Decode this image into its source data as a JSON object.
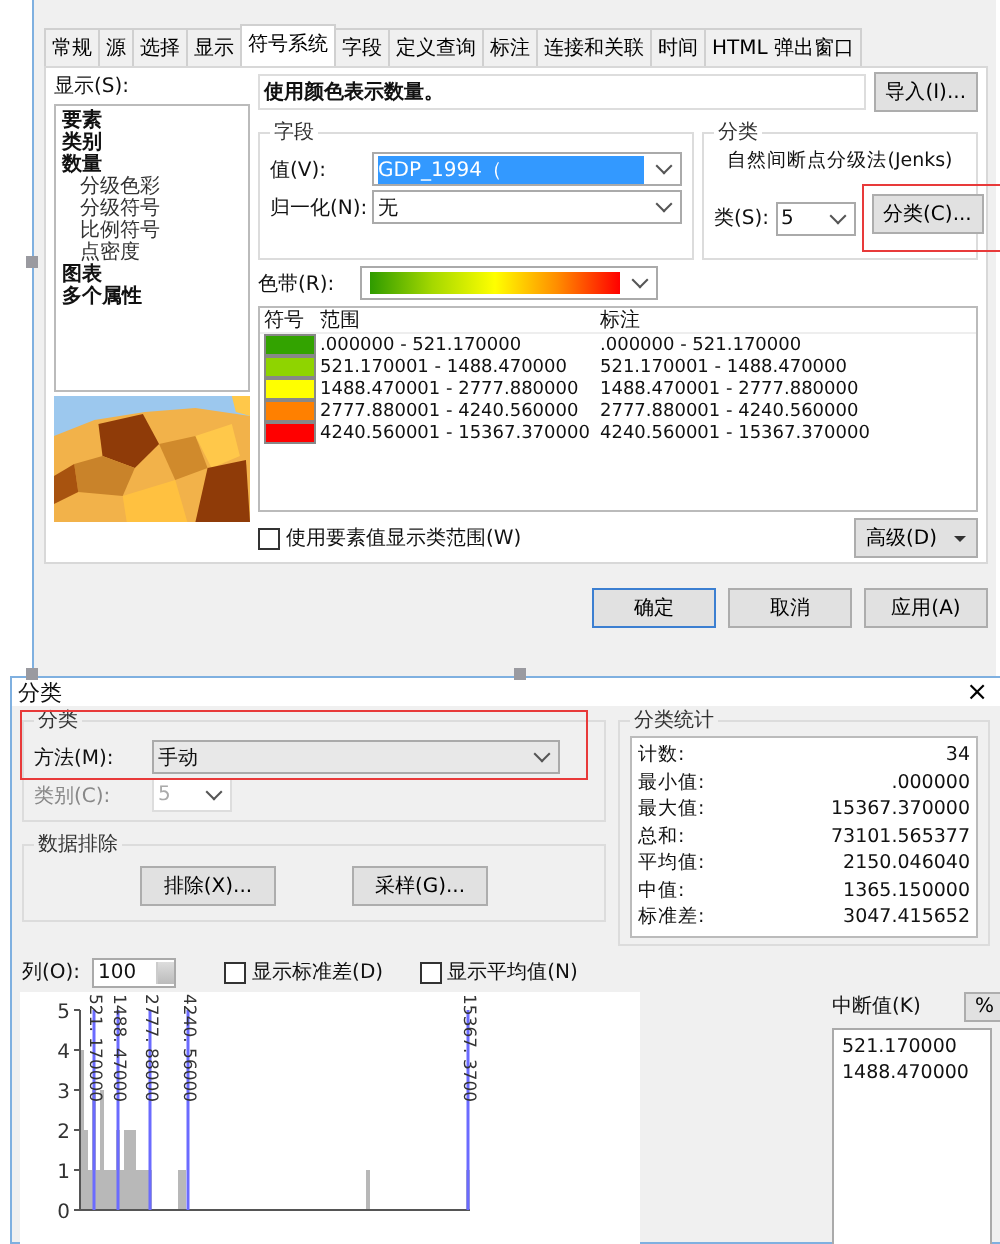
{
  "layer_properties": {
    "tabs": [
      {
        "label": "常规",
        "selected": false
      },
      {
        "label": "源",
        "selected": false
      },
      {
        "label": "选择",
        "selected": false
      },
      {
        "label": "显示",
        "selected": false
      },
      {
        "label": "符号系统",
        "selected": true
      },
      {
        "label": "字段",
        "selected": false
      },
      {
        "label": "定义查询",
        "selected": false
      },
      {
        "label": "标注",
        "selected": false
      },
      {
        "label": "连接和关联",
        "selected": false
      },
      {
        "label": "时间",
        "selected": false
      },
      {
        "label": "HTML 弹出窗口",
        "selected": false
      }
    ],
    "show_label": "显示(S):",
    "show_tree": [
      {
        "label": "要素"
      },
      {
        "label": "类别"
      },
      {
        "label": "数量",
        "children": [
          {
            "label": "分级色彩"
          },
          {
            "label": "分级符号"
          },
          {
            "label": "比例符号"
          },
          {
            "label": "点密度"
          }
        ]
      },
      {
        "label": "图表"
      },
      {
        "label": "多个属性"
      }
    ],
    "preview": {
      "kind": "picture"
    },
    "heading": "使用颜色表示数量。",
    "import_button": "导入(I)...",
    "field_group": {
      "title": "字段",
      "value_label": "值(V):",
      "value": "GDP_1994（",
      "normalize_label": "归一化(N):",
      "normalize": "无"
    },
    "classification_group": {
      "title": "分类",
      "method": "自然间断点分级法(Jenks)",
      "classes_label": "类(S):",
      "classes": "5",
      "classify_button": "分类(C)..."
    },
    "color_ramp_label": "色带(R):",
    "table": {
      "columns": [
        "符号",
        "范围",
        "标注"
      ],
      "rows": [
        {
          "color": "#33a300",
          "range": ".000000 - 521.170000",
          "label": ".000000 - 521.170000"
        },
        {
          "color": "#8fd400",
          "range": "521.170001 - 1488.470000",
          "label": "521.170001 - 1488.470000"
        },
        {
          "color": "#ffff00",
          "range": "1488.470001 - 2777.880000",
          "label": "1488.470001 - 2777.880000"
        },
        {
          "color": "#ff8000",
          "range": "2777.880001 - 4240.560000",
          "label": "2777.880001 - 4240.560000"
        },
        {
          "color": "#ff0000",
          "range": "4240.560001 - 15367.370000",
          "label": "4240.560001 - 15367.370000"
        }
      ]
    },
    "use_feature_values": {
      "label": "使用要素值显示类范围(W)",
      "checked": false
    },
    "advanced_button": "高级(D)",
    "buttons": [
      "确定",
      "取消",
      "应用(A)"
    ]
  },
  "classification_dialog": {
    "title": "分类",
    "close": "×",
    "group_title": "分类",
    "method_label": "方法(M):",
    "method": "手动",
    "classes_label": "类别(C):",
    "classes": "5",
    "classes_disabled": true,
    "exclusion_title": "数据排除",
    "exclude_button": "排除(X)...",
    "sampling_button": "采样(G)...",
    "stats_title": "分类统计",
    "stats": [
      {
        "name": "计数:",
        "value": "34"
      },
      {
        "name": "最小值:",
        "value": ".000000"
      },
      {
        "name": "最大值:",
        "value": "15367.370000"
      },
      {
        "name": "总和:",
        "value": "73101.565377"
      },
      {
        "name": "平均值:",
        "value": "2150.046040"
      },
      {
        "name": "中值:",
        "value": "1365.150000"
      },
      {
        "name": "标准差:",
        "value": "3047.415652"
      }
    ],
    "columns_label": "列(O):",
    "columns": "100",
    "show_std": {
      "label": "显示标准差(D)",
      "checked": false
    },
    "show_mean": {
      "label": "显示平均值(N)",
      "checked": false
    },
    "histogram": {
      "y_labels": [
        "5",
        "4",
        "3",
        "2",
        "1",
        "0"
      ],
      "break_labels": [
        "521. 170000",
        "1488. 47000",
        "2777. 88000",
        "4240. 56000",
        "15367. 3700"
      ]
    },
    "breaks_label": "中断值(K)",
    "percent_button": "%",
    "breaks": [
      "521.170000",
      "1488.470000"
    ]
  }
}
